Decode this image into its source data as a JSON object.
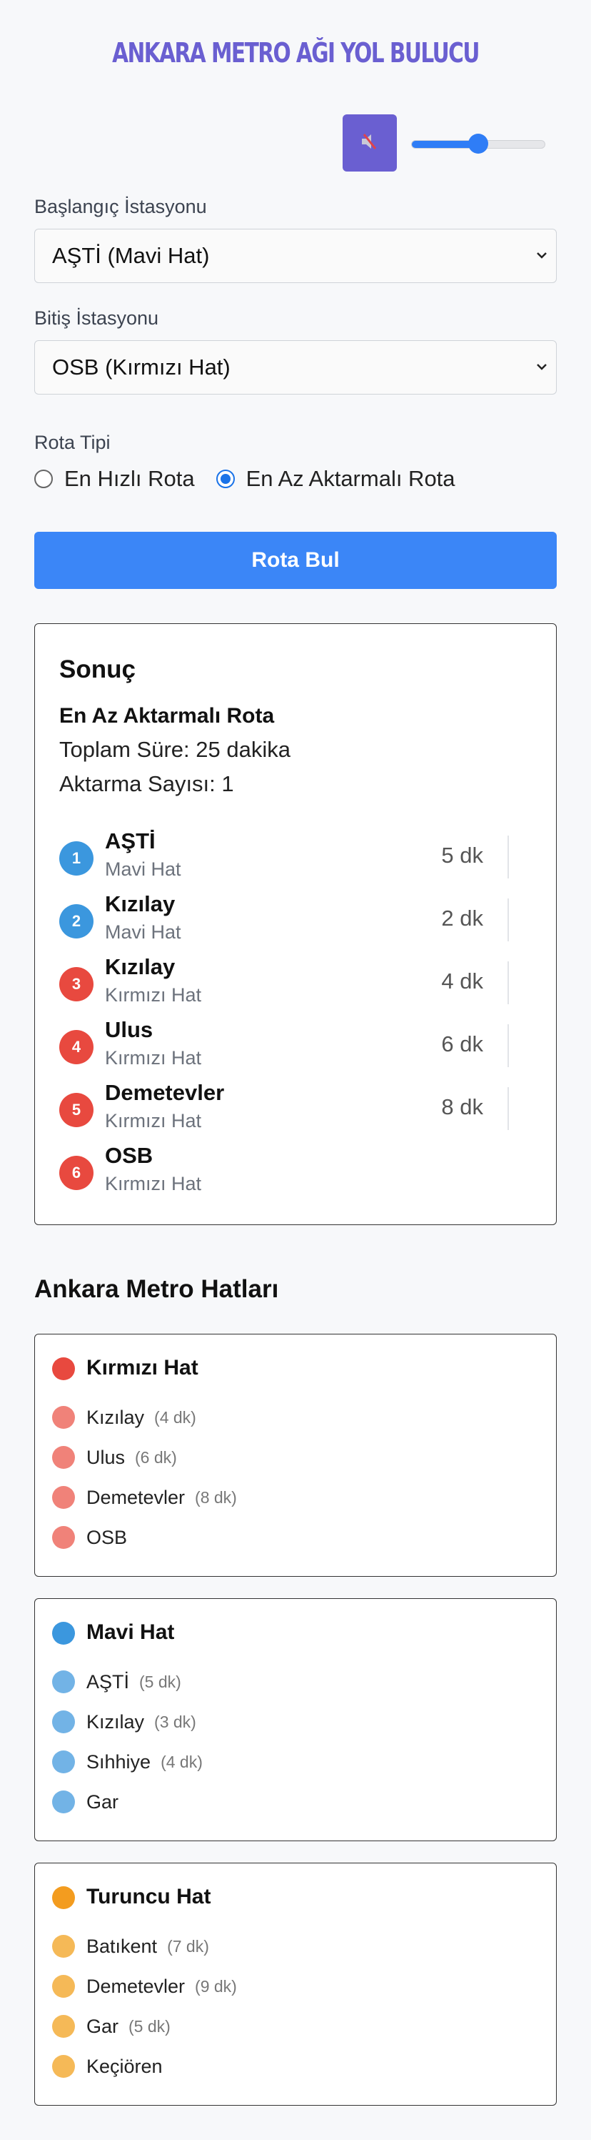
{
  "app": {
    "title": "ANKARA METRO AĞI YOL BULUCU"
  },
  "sound": {
    "volume_percent": 50,
    "mute_icon": "speaker-muted-icon"
  },
  "form": {
    "start_label": "Başlangıç İstasyonu",
    "start_value": "AŞTİ (Mavi Hat)",
    "end_label": "Bitiş İstasyonu",
    "end_value": "OSB (Kırmızı Hat)",
    "route_type_label": "Rota Tipi",
    "options": [
      {
        "label": "En Hızlı Rota",
        "selected": false
      },
      {
        "label": "En Az Aktarmalı Rota",
        "selected": true
      }
    ],
    "submit_label": "Rota Bul"
  },
  "result": {
    "title": "Sonuç",
    "route_type": "En Az Aktarmalı Rota",
    "total_time": "Toplam Süre: 25 dakika",
    "transfers": "Aktarma Sayısı: 1",
    "steps": [
      {
        "n": "1",
        "station": "AŞTİ",
        "line": "Mavi Hat",
        "duration": "5 dk",
        "color": "#3b97de"
      },
      {
        "n": "2",
        "station": "Kızılay",
        "line": "Mavi Hat",
        "duration": "2 dk",
        "color": "#3b97de"
      },
      {
        "n": "3",
        "station": "Kızılay",
        "line": "Kırmızı Hat",
        "duration": "4 dk",
        "color": "#e8493f"
      },
      {
        "n": "4",
        "station": "Ulus",
        "line": "Kırmızı Hat",
        "duration": "6 dk",
        "color": "#e8493f"
      },
      {
        "n": "5",
        "station": "Demetevler",
        "line": "Kırmızı Hat",
        "duration": "8 dk",
        "color": "#e8493f"
      },
      {
        "n": "6",
        "station": "OSB",
        "line": "Kırmızı Hat",
        "duration": "",
        "color": "#e8493f"
      }
    ]
  },
  "lines_section": {
    "title": "Ankara Metro Hatları",
    "lines": [
      {
        "name": "Kırmızı Hat",
        "color": "#e8493f",
        "light": "#f08279",
        "stations": [
          {
            "name": "Kızılay",
            "duration": "(4 dk)"
          },
          {
            "name": "Ulus",
            "duration": "(6 dk)"
          },
          {
            "name": "Demetevler",
            "duration": "(8 dk)"
          },
          {
            "name": "OSB",
            "duration": ""
          }
        ]
      },
      {
        "name": "Mavi Hat",
        "color": "#3b97de",
        "light": "#72b3e6",
        "stations": [
          {
            "name": "AŞTİ",
            "duration": "(5 dk)"
          },
          {
            "name": "Kızılay",
            "duration": "(3 dk)"
          },
          {
            "name": "Sıhhiye",
            "duration": "(4 dk)"
          },
          {
            "name": "Gar",
            "duration": ""
          }
        ]
      },
      {
        "name": "Turuncu Hat",
        "color": "#f39c1f",
        "light": "#f5b957",
        "stations": [
          {
            "name": "Batıkent",
            "duration": "(7 dk)"
          },
          {
            "name": "Demetevler",
            "duration": "(9 dk)"
          },
          {
            "name": "Gar",
            "duration": "(5 dk)"
          },
          {
            "name": "Keçiören",
            "duration": ""
          }
        ]
      }
    ]
  }
}
